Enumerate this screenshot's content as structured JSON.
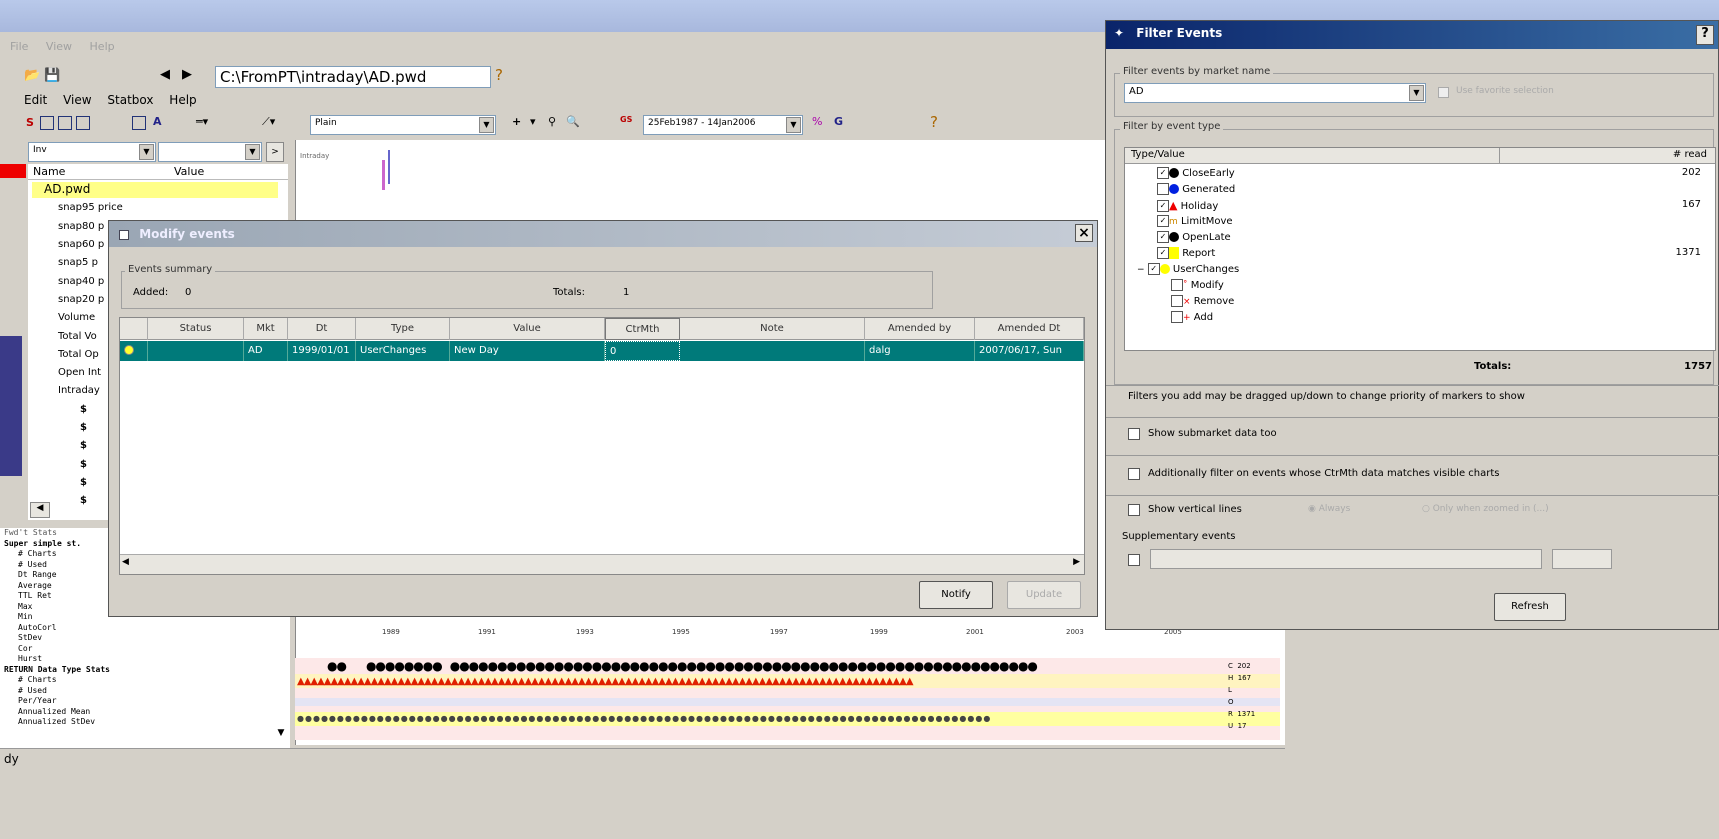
{
  "main": {
    "menu_faded": [
      "File",
      "View",
      "Help"
    ],
    "path": "C:\\FromPT\\intraday\\AD.pwd",
    "menu": [
      "Edit",
      "View",
      "Statbox",
      "Help"
    ],
    "style_select": "Plain",
    "date_range": "25Feb1987 - 14Jan2006",
    "gs_label": "GS",
    "left_combo": "Inv",
    "chart_label": "Intraday",
    "status_text": "dy"
  },
  "tree": {
    "col_name": "Name",
    "col_value": "Value",
    "root": "AD.pwd",
    "items": [
      "snap95 price",
      "snap80 p",
      "snap60 p",
      "snap5 p",
      "snap40 p",
      "snap20 p",
      "Volume",
      "Total Vo",
      "Total Op",
      "Open Int",
      "Intraday"
    ],
    "dollar_items": [
      "$",
      "$",
      "$",
      "$",
      "$",
      "$"
    ]
  },
  "stats": {
    "header": "Fwd't Stats",
    "lines": [
      "Super simple st.",
      "# Charts",
      "# Used",
      "Dt Range",
      "Average",
      "TTL Ret",
      "Max",
      "Min",
      "AutoCorl",
      "StDev",
      "Cor",
      "Hurst",
      "RETURN Data Type Stats",
      "# Charts",
      "# Used",
      "Per/Year",
      "Annualized Mean",
      "Annualized StDev"
    ]
  },
  "chart": {
    "x_ticks": [
      "1989",
      "1991",
      "1993",
      "1995",
      "1997",
      "1999",
      "2001",
      "2003",
      "2005"
    ],
    "row_labels": [
      "C",
      "H",
      "L",
      "O",
      "R",
      "U"
    ],
    "row_counts": [
      "202",
      "167",
      "",
      "",
      "1371",
      "17"
    ]
  },
  "modify": {
    "title": "Modify events",
    "summary_label": "Events summary",
    "added_label": "Added:",
    "added_value": "0",
    "totals_label": "Totals:",
    "totals_value": "1",
    "columns": [
      "Status",
      "Mkt",
      "Dt",
      "Type",
      "Value",
      "CtrMth",
      "Note",
      "Amended by",
      "Amended Dt"
    ],
    "row": {
      "status": "",
      "mkt": "AD",
      "dt": "1999/01/01",
      "type": "UserChanges",
      "value": "New Day",
      "ctrmth": "0",
      "note": "",
      "amended_by": "dalg",
      "amended_dt": "2007/06/17, Sun"
    },
    "notify": "Notify",
    "update": "Update",
    "close": "×"
  },
  "filter": {
    "title": "Filter Events",
    "help": "?",
    "by_market_label": "Filter events by market name",
    "market_value": "AD",
    "favorite_label": "Use favorite selection",
    "by_type_label": "Filter by event type",
    "col_type": "Type/Value",
    "col_read": "# read",
    "events": [
      {
        "name": "CloseEarly",
        "count": "202"
      },
      {
        "name": "Generated",
        "count": ""
      },
      {
        "name": "Holiday",
        "count": "167"
      },
      {
        "name": "LimitMove",
        "count": ""
      },
      {
        "name": "OpenLate",
        "count": ""
      },
      {
        "name": "Report",
        "count": "1371"
      },
      {
        "name": "UserChanges",
        "count": ""
      },
      {
        "name": "Modify",
        "count": ""
      },
      {
        "name": "Remove",
        "count": ""
      },
      {
        "name": "Add",
        "count": ""
      }
    ],
    "totals_label": "Totals:",
    "totals_value": "1757",
    "drag_hint": "Filters you add may be dragged up/down to change priority of markers to show",
    "submarket": "Show submarket data too",
    "ctrmth_filter": "Additionally filter on events whose CtrMth data matches visible charts",
    "vertical_lines": "Show vertical lines",
    "always": "Always",
    "zoomed": "Only when zoomed in (...)",
    "supplementary": "Supplementary events",
    "refresh": "Refresh"
  },
  "colors": {
    "selected_row": "#007a7a",
    "title_active": "#0a246a",
    "highlight": "#ffff88"
  }
}
